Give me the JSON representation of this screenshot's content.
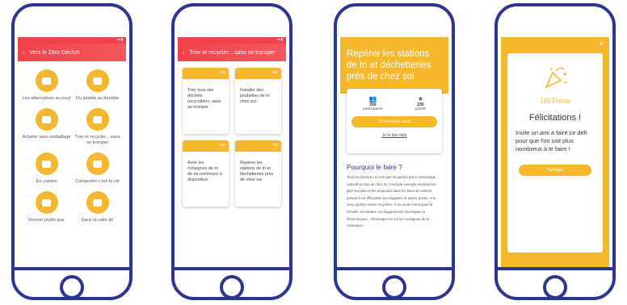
{
  "phone1": {
    "title": "Vers le Zéro Déchet",
    "items": [
      "Les alternatives au neuf",
      "Du jetable au durable",
      "Acheter sans emballage",
      "Trier et recycler... sans se tromper",
      "En cuisine",
      "Composter c'est la clé",
      "Donner plutôt que",
      "Dans la salle de"
    ]
  },
  "phone2": {
    "title": "Trier et recycler... sans se tromper",
    "cards": [
      {
        "text": "Trier tous ses déchets recyclables, sans se tromper",
        "points": "400"
      },
      {
        "text": "Installer des poubelles de tri chez soi",
        "points": "445"
      },
      {
        "text": "Avoir les consignes de tri de sa commune à disposition",
        "points": "444"
      },
      {
        "text": "Repérer les stations de tri et déchetteries près de chez soi",
        "points": "770"
      }
    ]
  },
  "phone3": {
    "title": "Repérer les stations de tri et déchetteries près de chez soi",
    "participants_value": "356",
    "participants_label": "participants",
    "points_value": "230",
    "points_label": "points",
    "cta": "Je me lance aussi",
    "already": "Je le fais déjà",
    "why_title": "Pourquoi le faire ?",
    "why_text": "Tous les déchets ne sont pas récupérés par le ramassage collectif en bas de chez toi. Il est par exemple essentiel de jeter les piles et les ampoules dans les bacs de collecte prévus à cet effet dans les magasins et autres points, si tu veux qu'elles soient recyclées. Il en va de même pour la ferraille, les ailettes, les équipements électriques et électroniques... Renseigne-toi sur les consignes de ta commune !"
  },
  "phone4": {
    "points": "115 Points",
    "heading": "Félicitations !",
    "message": "Invite un ami à faire ce défi pour que l'on soit plus nombreux à le faire !",
    "share": "Partager"
  }
}
